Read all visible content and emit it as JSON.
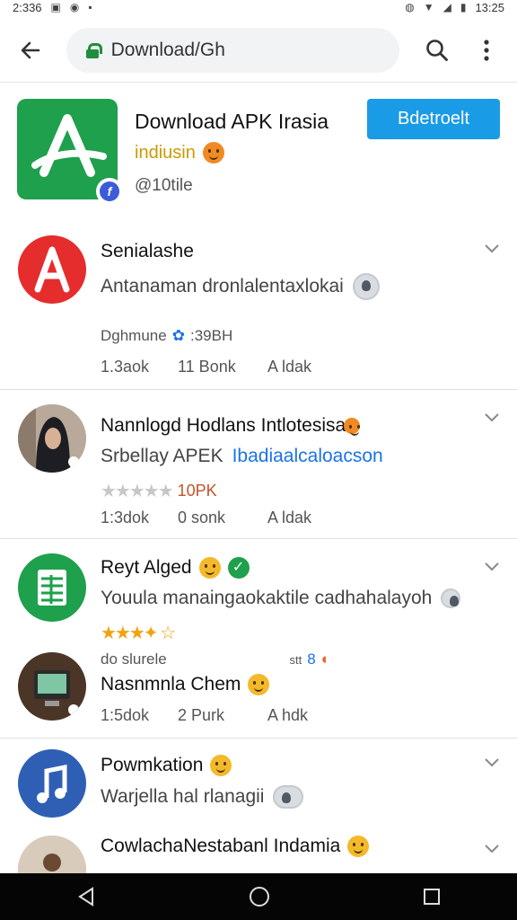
{
  "status_bar": {
    "time_left": "2:336",
    "time_right": "13:25"
  },
  "toolbar": {
    "url": "Download/Gh"
  },
  "hero": {
    "title": "Download APK Irasia",
    "subtitle": "indiusin",
    "meta": "@10tile",
    "button_label": "Bdetroelt",
    "colors": {
      "logo_bg": "#1ea04c",
      "button_bg": "#1a9be6",
      "subtitle": "#c99a05"
    }
  },
  "items": [
    {
      "title": "Senialashe",
      "desc": "Antanaman dronlalentaxlokai",
      "line3": "Dghmune",
      "line3b": ":39BH",
      "stats": [
        "1.3aok",
        "11 Bonk",
        "A ldak"
      ],
      "avatar_color": "#e52d2d",
      "icon": "letter-a-icon"
    },
    {
      "title": "Nannlogd Hodlans Intlotesisa",
      "desc_a": "Srbellay APEK",
      "desc_b": "Ibadiaalcaloacson",
      "rating_text": "10PK",
      "stats": [
        "1:3dok",
        "0 sonk",
        "A ldak"
      ],
      "icon": "person-photo"
    },
    {
      "title": "Reyt Alged",
      "desc": "Youula manaingaokaktile cadhahalayoh",
      "line3": "do slurele",
      "line3b": "stt",
      "sub_title": "Nasnmnla Chem",
      "stats": [
        "1:5dok",
        "2 Purk",
        "A hdk"
      ],
      "avatar_color": "#1ea04c",
      "icon": "spreadsheet-icon"
    },
    {
      "title": "Powmkation",
      "desc": "Warjella hal rlanagii",
      "avatar_color": "#2f5fb5",
      "icon": "music-note-icon"
    },
    {
      "title": "CowlachaNestabanl Indamia",
      "icon": "person-photo"
    }
  ]
}
